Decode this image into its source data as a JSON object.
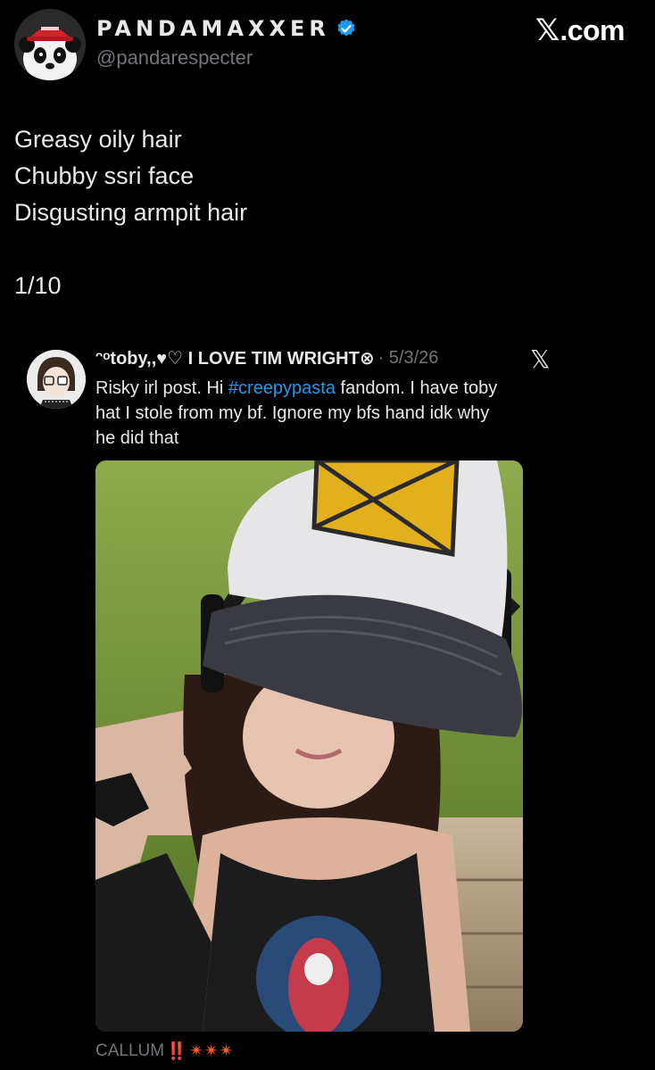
{
  "author": {
    "display_name": "PANDAMAXXER",
    "handle": "@pandarespecter",
    "verified": true,
    "avatar_icon": "panda-avatar-icon"
  },
  "brand": {
    "glyph": "𝕏",
    "text": ".com"
  },
  "tweet": {
    "lines": [
      "Greasy oily hair",
      "Chubby ssri face",
      "Disgusting armpit hair",
      "",
      "1/10"
    ]
  },
  "quoted": {
    "name": "ᵔᵒtoby,,♥♡ I LOVE TIM WRIGHT⊗",
    "date": "· 5/3/26",
    "close_glyph": "𝕏",
    "text_line1_prefix": "Risky irl post. Hi ",
    "hashtag": "#creepypasta",
    "text_line1_suffix": " fandom. I have toby",
    "text_line2": "hat I stole from my bf. Ignore my bfs hand idk why",
    "text_line3": "he did that",
    "photo_icon": "selfie-photo"
  },
  "footer": {
    "label": "CALLUM",
    "mark": "‼️",
    "bursts": "✴✴✴"
  },
  "colors": {
    "background": "#000000",
    "text": "#e7e9ea",
    "muted": "#71767b",
    "link": "#1d9bf0",
    "verified": "#1d9bf0"
  }
}
